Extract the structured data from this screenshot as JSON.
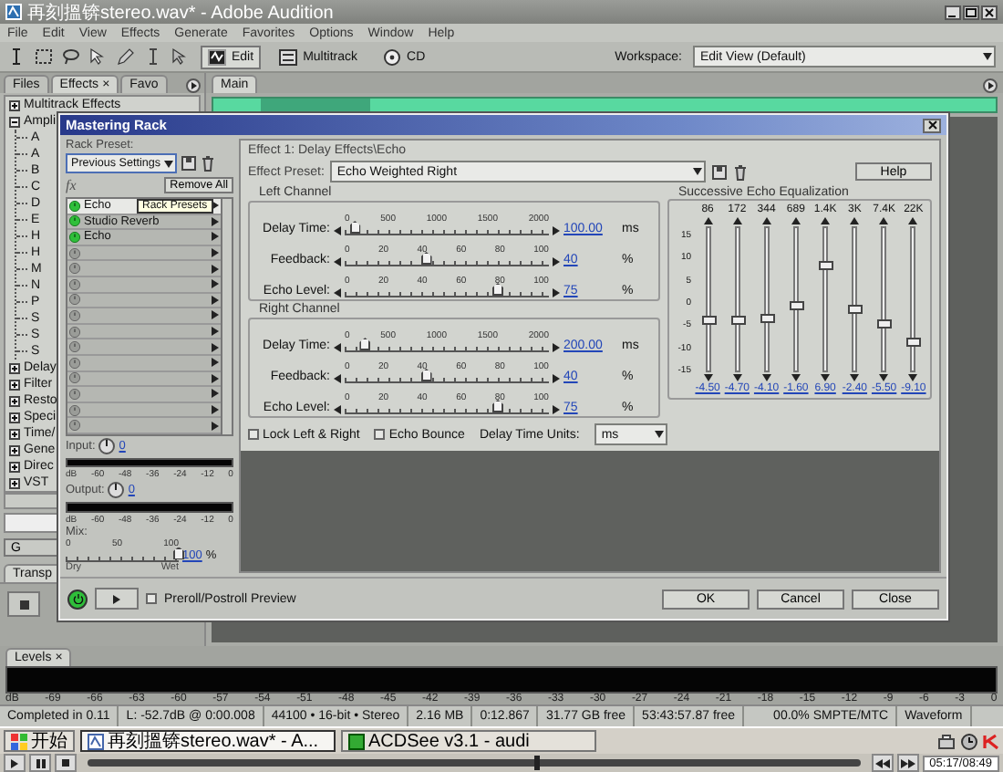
{
  "window": {
    "title": "再刻搵锛stereo.wav* - Adobe Audition"
  },
  "menu": [
    "File",
    "Edit",
    "View",
    "Effects",
    "Generate",
    "Favorites",
    "Options",
    "Window",
    "Help"
  ],
  "toolbar": {
    "views": [
      {
        "label": "Edit",
        "selected": true
      },
      {
        "label": "Multitrack",
        "selected": false
      },
      {
        "label": "CD",
        "selected": false
      }
    ],
    "workspace_label": "Workspace:",
    "workspace": "Edit View (Default)"
  },
  "left_panel": {
    "tabs": [
      {
        "label": "Files",
        "selected": false
      },
      {
        "label": "Effects",
        "selected": true,
        "close": "×"
      },
      {
        "label": "Favo",
        "selected": false
      }
    ],
    "tree": [
      {
        "label": "Multitrack Effects",
        "expanded": false
      },
      {
        "label": "Ampli",
        "expanded": true,
        "children": [
          {
            "label": "A"
          },
          {
            "label": "A"
          },
          {
            "label": "B"
          },
          {
            "label": "C"
          },
          {
            "label": "D"
          },
          {
            "label": "E"
          },
          {
            "label": "H"
          },
          {
            "label": "H"
          },
          {
            "label": "M"
          },
          {
            "label": "N"
          },
          {
            "label": "P"
          },
          {
            "label": "S"
          },
          {
            "label": "S"
          },
          {
            "label": "S"
          }
        ]
      },
      {
        "label": "Delay",
        "expanded": false
      },
      {
        "label": "Filter",
        "expanded": false
      },
      {
        "label": "Resto",
        "expanded": false
      },
      {
        "label": "Speci",
        "expanded": false
      },
      {
        "label": "Time/",
        "expanded": false
      },
      {
        "label": "Gene",
        "expanded": false
      },
      {
        "label": "Direc",
        "expanded": false
      },
      {
        "label": "VST",
        "expanded": false
      }
    ],
    "button": "G",
    "transport_tab": "Transp"
  },
  "main_tab": "Main",
  "levels": {
    "tab": "Levels",
    "close": "×",
    "scale": [
      "dB",
      "-69",
      "-66",
      "-63",
      "-60",
      "-57",
      "-54",
      "-51",
      "-48",
      "-45",
      "-42",
      "-39",
      "-36",
      "-33",
      "-30",
      "-27",
      "-24",
      "-21",
      "-18",
      "-15",
      "-12",
      "-9",
      "-6",
      "-3",
      "0"
    ]
  },
  "status_bar": [
    "Completed in 0.11",
    "L: -52.7dB @  0:00.008",
    "44100 • 16-bit • Stereo",
    "2.16 MB",
    "0:12.867",
    "31.77 GB free",
    "53:43:57.87 free",
    "00.0% SMPTE/MTC",
    "Waveform"
  ],
  "taskbar": {
    "start": "开始",
    "tasks": [
      {
        "label": "再刻搵锛stereo.wav* - A...",
        "selected": true
      },
      {
        "label": "ACDSee v3.1 - audi",
        "selected": false
      }
    ]
  },
  "player": {
    "level": 0.58,
    "time": "05:17/08:49"
  },
  "dialog": {
    "title": "Mastering Rack",
    "rack_preset_label": "Rack Preset:",
    "rack_preset": "Previous Settings",
    "fx_label": "fx",
    "remove_all": "Remove All",
    "tooltip": "Rack Presets",
    "slots": [
      {
        "name": "Echo",
        "on": true,
        "selected": true
      },
      {
        "name": "Studio Reverb",
        "on": true,
        "selected": false
      },
      {
        "name": "Echo",
        "on": true,
        "selected": false
      },
      {
        "on": false,
        "selected": false
      },
      {
        "on": false,
        "selected": false
      },
      {
        "on": false,
        "selected": false
      },
      {
        "on": false,
        "selected": false
      },
      {
        "on": false,
        "selected": false
      },
      {
        "on": false,
        "selected": false
      },
      {
        "on": false,
        "selected": false
      },
      {
        "on": false,
        "selected": false
      },
      {
        "on": false,
        "selected": false
      },
      {
        "on": false,
        "selected": false
      },
      {
        "on": false,
        "selected": false
      },
      {
        "on": false,
        "selected": false
      }
    ],
    "input": {
      "label": "Input:",
      "value": "0",
      "scale": [
        "dB",
        "-60",
        "-48",
        "-36",
        "-24",
        "-12",
        "0"
      ]
    },
    "output": {
      "label": "Output:",
      "value": "0",
      "scale": [
        "dB",
        "-60",
        "-48",
        "-36",
        "-24",
        "-12",
        "0"
      ]
    },
    "mix": {
      "label": "Mix:",
      "ticks": [
        "0",
        "50",
        "100"
      ],
      "level": 1,
      "value": "100",
      "unit": "%",
      "left": "Dry",
      "right": "Wet"
    },
    "effect": {
      "title": "Effect 1: Delay Effects\\Echo",
      "preset_label": "Effect Preset:",
      "preset": "Echo Weighted Right",
      "help": "Help",
      "channels": [
        {
          "title": "Left Channel",
          "params": [
            {
              "label": "Delay Time:",
              "ticks": [
                "0",
                "500",
                "1000",
                "1500",
                "2000"
              ],
              "level": 0.05,
              "value": "100.00",
              "unit": "ms"
            },
            {
              "label": "Feedback:",
              "ticks": [
                "0",
                "20",
                "40",
                "60",
                "80",
                "100"
              ],
              "level": 0.4,
              "value": "40",
              "unit": "%"
            },
            {
              "label": "Echo Level:",
              "ticks": [
                "0",
                "20",
                "40",
                "60",
                "80",
                "100"
              ],
              "level": 0.75,
              "value": "75",
              "unit": "%"
            }
          ]
        },
        {
          "title": "Right Channel",
          "params": [
            {
              "label": "Delay Time:",
              "ticks": [
                "0",
                "500",
                "1000",
                "1500",
                "2000"
              ],
              "level": 0.1,
              "value": "200.00",
              "unit": "ms"
            },
            {
              "label": "Feedback:",
              "ticks": [
                "0",
                "20",
                "40",
                "60",
                "80",
                "100"
              ],
              "level": 0.4,
              "value": "40",
              "unit": "%"
            },
            {
              "label": "Echo Level:",
              "ticks": [
                "0",
                "20",
                "40",
                "60",
                "80",
                "100"
              ],
              "level": 0.75,
              "value": "75",
              "unit": "%"
            }
          ]
        }
      ],
      "options": [
        {
          "label": "Lock Left & Right",
          "checked": false
        },
        {
          "label": "Echo Bounce",
          "checked": false
        }
      ],
      "units_label": "Delay Time Units:",
      "units": "ms",
      "eq": {
        "title": "Successive Echo Equalization",
        "scale": [
          "15",
          "10",
          "5",
          "0",
          "-5",
          "-10",
          "-15"
        ],
        "bands": [
          {
            "label": "86",
            "level": 0.35,
            "value": "-4.50"
          },
          {
            "label": "172",
            "level": 0.343,
            "value": "-4.70"
          },
          {
            "label": "344",
            "level": 0.363,
            "value": "-4.10"
          },
          {
            "label": "689",
            "level": 0.447,
            "value": "-1.60"
          },
          {
            "label": "1.4K",
            "level": 0.73,
            "value": "6.90"
          },
          {
            "label": "3K",
            "level": 0.42,
            "value": "-2.40"
          },
          {
            "label": "7.4K",
            "level": 0.317,
            "value": "-5.50"
          },
          {
            "label": "22K",
            "level": 0.197,
            "value": "-9.10"
          }
        ]
      }
    },
    "power_on": true,
    "preview": {
      "label": "Preroll/Postroll Preview",
      "checked": false
    },
    "buttons": [
      "OK",
      "Cancel",
      "Close"
    ]
  }
}
